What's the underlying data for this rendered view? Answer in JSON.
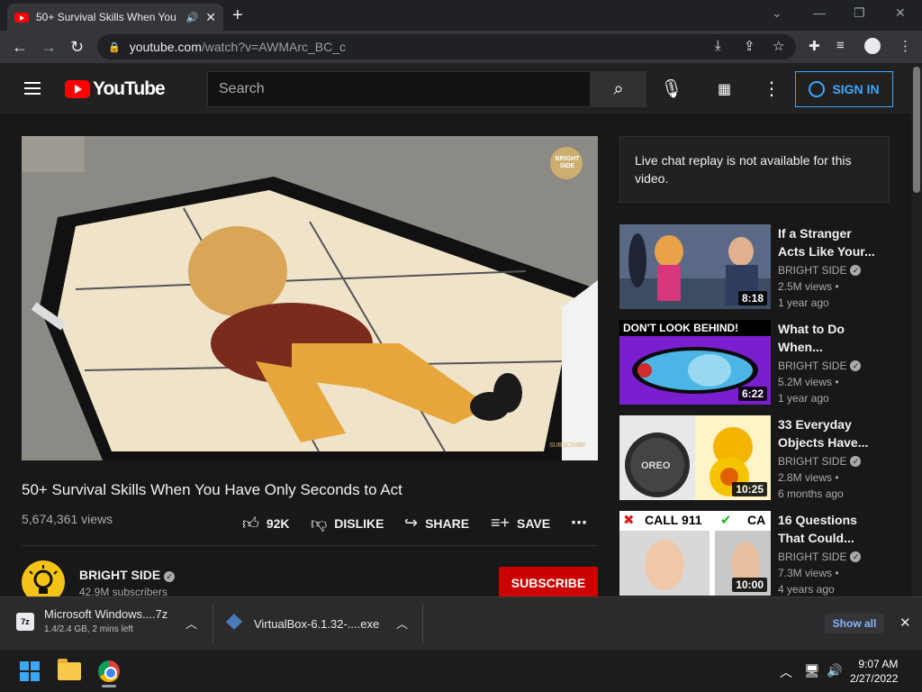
{
  "browser": {
    "tab_title": "50+ Survival Skills When You",
    "new_tab_icon": "+",
    "url_host": "youtube.com",
    "url_path": "/watch?v=AWMArc_BC_c"
  },
  "youtube": {
    "logo_text": "YouTube",
    "search_placeholder": "Search",
    "signin_label": "SIGN IN"
  },
  "video": {
    "title": "50+ Survival Skills When You Have Only Seconds to Act",
    "views": "5,674,361 views",
    "likes": "92K",
    "dislike_label": "DISLIKE",
    "share_label": "SHARE",
    "save_label": "SAVE",
    "watermark": "BRIGHT SIDE",
    "watermark_sub": "SUBSCRIBE"
  },
  "channel": {
    "name": "BRIGHT SIDE",
    "subscribers": "42.9M subscribers",
    "subscribe_label": "SUBSCRIBE"
  },
  "chat_notice": "Live chat replay is not available for this video.",
  "recommendations": [
    {
      "title": "If a Stranger Acts Like Your...",
      "channel": "BRIGHT SIDE",
      "views": "2.5M views •",
      "age": "1 year ago",
      "duration": "8:18"
    },
    {
      "title": "What to Do When...",
      "channel": "BRIGHT SIDE",
      "views": "5.2M views •",
      "age": "1 year ago",
      "duration": "6:22",
      "thumb_text": "DON'T LOOK BEHIND!"
    },
    {
      "title": "33 Everyday Objects Have...",
      "channel": "BRIGHT SIDE",
      "views": "2.8M views •",
      "age": "6 months ago",
      "duration": "10:25",
      "thumb_text": "OREO"
    },
    {
      "title": "16 Questions That Could...",
      "channel": "BRIGHT SIDE",
      "views": "7.3M views •",
      "age": "4 years ago",
      "duration": "10:00",
      "thumb_text_1": "CALL 911",
      "thumb_text_2": "CA"
    }
  ],
  "downloads": {
    "items": [
      {
        "name": "Microsoft Windows....7z",
        "status": "1.4/2.4 GB, 2 mins left"
      },
      {
        "name": "VirtualBox-6.1.32-....exe"
      }
    ],
    "show_all": "Show all"
  },
  "taskbar": {
    "time": "9:07 AM",
    "date": "2/27/2022"
  },
  "colors": {
    "youtube_red": "#ff0000",
    "subscribe_red": "#cc0000",
    "signin_blue": "#3ea6ff",
    "background": "#181818"
  }
}
